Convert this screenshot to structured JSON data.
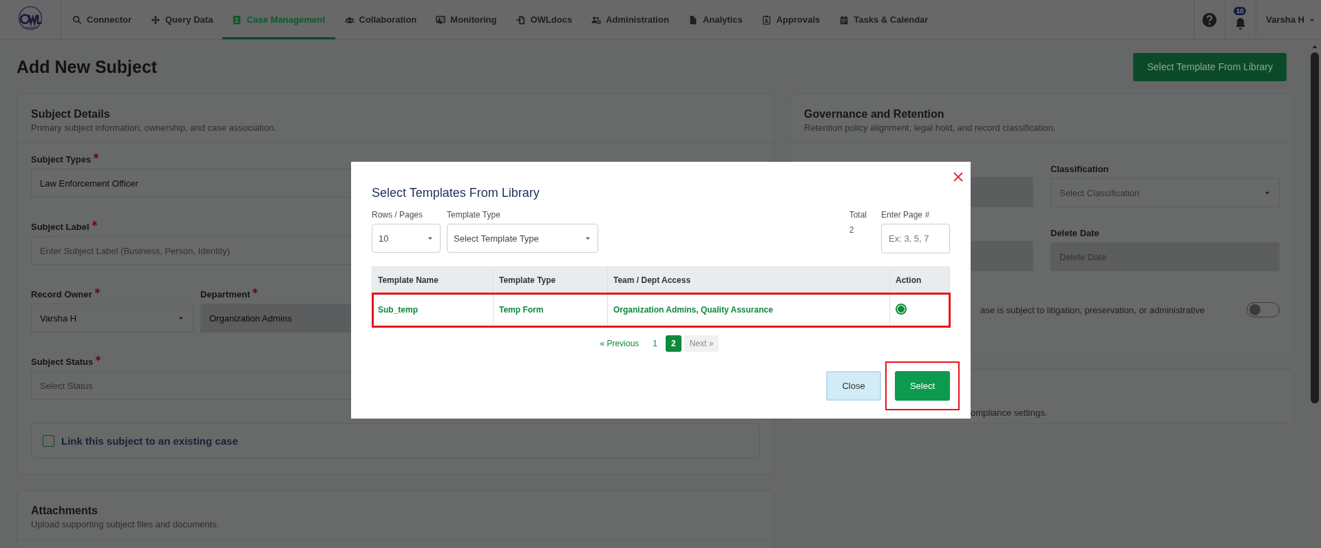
{
  "nav": {
    "items": [
      {
        "label": "Connector",
        "selected": false
      },
      {
        "label": "Query Data",
        "selected": false
      },
      {
        "label": "Case Management",
        "selected": true
      },
      {
        "label": "Collaboration",
        "selected": false
      },
      {
        "label": "Monitoring",
        "selected": false
      },
      {
        "label": "OWLdocs",
        "selected": false
      },
      {
        "label": "Administration",
        "selected": false
      },
      {
        "label": "Analytics",
        "selected": false
      },
      {
        "label": "Approvals",
        "selected": false
      },
      {
        "label": "Tasks & Calendar",
        "selected": false
      }
    ],
    "notifications": "10",
    "user": "Varsha H"
  },
  "page": {
    "title": "Add New Subject",
    "library_button": "Select Template From Library"
  },
  "subject_details": {
    "title": "Subject Details",
    "subtitle": "Primary subject information, ownership, and case association.",
    "rows": [
      [
        {
          "label": "Subject Types",
          "required": true,
          "value": "Law Enforcement Officer",
          "kind": "text"
        }
      ],
      [
        {
          "label": "Subject Label",
          "required": true,
          "placeholder": "Enter Subject Label (Business, Person, Identity)",
          "kind": "text"
        }
      ],
      [
        {
          "label": "Record Owner",
          "required": true,
          "value": "Varsha H",
          "kind": "select"
        },
        {
          "label": "Department",
          "required": true,
          "value": "Organization Admins",
          "kind": "disabled"
        }
      ],
      [
        {
          "label": "Subject Status",
          "required": true,
          "placeholder": "Select Status",
          "kind": "text"
        }
      ]
    ],
    "link_case": {
      "label": "Link this subject to an existing case",
      "checked": false
    }
  },
  "governance": {
    "title": "Governance and Retention",
    "subtitle": "Retention policy alignment, legal hold, and record classification.",
    "fields": [
      {
        "label": "Classification",
        "placeholder": "Select Classification",
        "kind": "select"
      },
      {
        "label": "Delete Date",
        "placeholder": "Delete Date",
        "kind": "disabled"
      }
    ],
    "legal_hold": {
      "text": "ase is subject to litigation, preservation, or administrative",
      "on": false
    }
  },
  "compliance_card": {
    "text": "ompliance settings."
  },
  "attachments": {
    "title": "Attachments",
    "subtitle": "Upload supporting subject files and documents."
  },
  "modal": {
    "title": "Select Templates From Library",
    "rows_per_page": {
      "label": "Rows / Pages",
      "value": "10"
    },
    "template_type": {
      "label": "Template Type",
      "placeholder": "Select Template Type"
    },
    "total": {
      "label": "Total",
      "value": "2"
    },
    "page_input": {
      "label": "Enter Page #",
      "placeholder": "Ex: 3, 5, 7"
    },
    "table": {
      "columns": [
        "Template Name",
        "Template Type",
        "Team / Dept Access",
        "Action"
      ],
      "rows": [
        {
          "cells": [
            "Sub_temp",
            "Temp Form",
            "Organization Admins, Quality Assurance"
          ],
          "selected": true,
          "highlighted": true
        }
      ]
    },
    "pagination": {
      "previous": "« Previous",
      "pages": [
        {
          "label": "1",
          "selected": false
        },
        {
          "label": "2",
          "selected": true
        }
      ],
      "next": "Next »",
      "next_disabled": true
    },
    "buttons": [
      {
        "label": "Close",
        "kind": "secondary",
        "highlighted": false
      },
      {
        "label": "Select",
        "kind": "primary",
        "highlighted": true
      }
    ]
  }
}
